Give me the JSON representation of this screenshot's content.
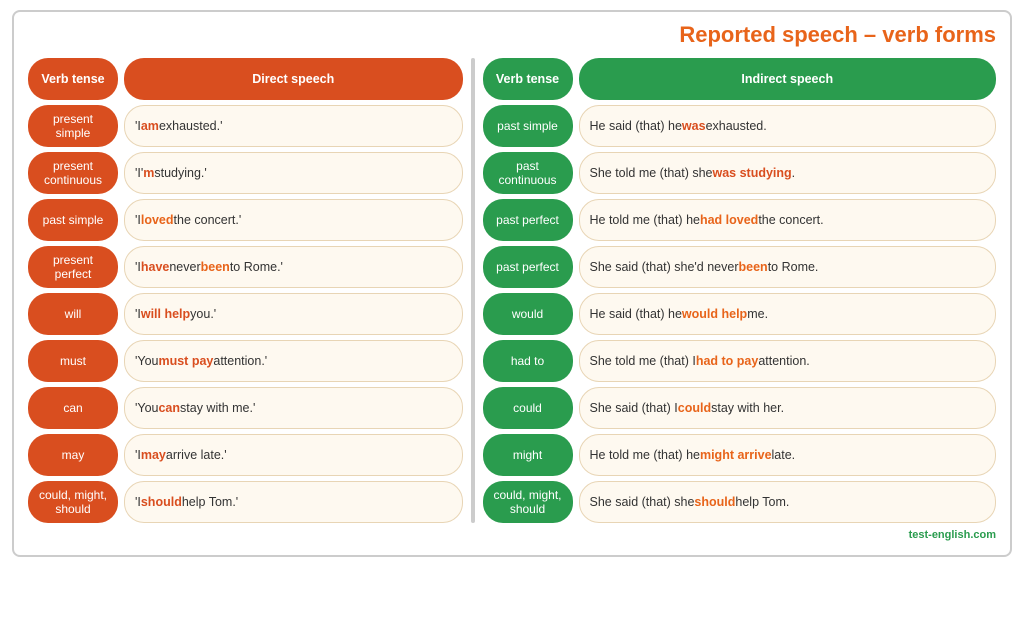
{
  "title": "Reported speech – verb forms",
  "direct_section": {
    "col1_header": "Verb tense",
    "col2_header": "Direct speech",
    "rows": [
      {
        "verb_tense": "present simple",
        "speech_html": "'I <b class=\"highlight-red\">am</b> exhausted.'"
      },
      {
        "verb_tense": "present continuous",
        "speech_html": "'I'<b class=\"highlight-red\">m</b> studying.'"
      },
      {
        "verb_tense": "past simple",
        "speech_html": "'I <b class=\"highlight-orange\">loved</b> the concert.'"
      },
      {
        "verb_tense": "present perfect",
        "speech_html": "'I <b class=\"highlight-red\">have</b> never <b class=\"highlight-orange\">been</b> to Rome.'"
      },
      {
        "verb_tense": "will",
        "speech_html": "'I <b class=\"highlight-red\">will help</b> you.'"
      },
      {
        "verb_tense": "must",
        "speech_html": "'You <b class=\"highlight-red\">must pay</b> attention.'"
      },
      {
        "verb_tense": "can",
        "speech_html": "'You <b class=\"highlight-red\">can</b> stay with me.'"
      },
      {
        "verb_tense": "may",
        "speech_html": "'I <b class=\"highlight-red\">may</b> arrive late.'"
      },
      {
        "verb_tense": "could, might, should",
        "speech_html": "'I <b class=\"highlight-red\">should</b> help Tom.'"
      }
    ]
  },
  "indirect_section": {
    "col1_header": "Verb tense",
    "col2_header": "Indirect speech",
    "rows": [
      {
        "verb_tense": "past simple",
        "speech_html": "He said (that) he <b class=\"highlight-red\">was</b> exhausted."
      },
      {
        "verb_tense": "past continuous",
        "speech_html": "She told me (that) she <b class=\"highlight-red\">was studying</b>."
      },
      {
        "verb_tense": "past perfect",
        "speech_html": "He told me (that) he <b class=\"highlight-orange\">had loved</b> the concert."
      },
      {
        "verb_tense": "past perfect",
        "speech_html": "She said (that) she'd never <b class=\"highlight-orange\">been</b> to Rome."
      },
      {
        "verb_tense": "would",
        "speech_html": "He said (that) he <b class=\"highlight-orange\">would help</b> me."
      },
      {
        "verb_tense": "had to",
        "speech_html": "She told me (that) I <b class=\"highlight-orange\">had to pay</b> attention."
      },
      {
        "verb_tense": "could",
        "speech_html": "She said (that) I <b class=\"highlight-orange\">could</b> stay with her."
      },
      {
        "verb_tense": "might",
        "speech_html": "He told me (that) he <b class=\"highlight-orange\">might arrive</b> late."
      },
      {
        "verb_tense": "could, might, should",
        "speech_html": "She said (that) she <b class=\"highlight-orange\">should</b> help Tom."
      }
    ]
  },
  "footer": "test-english.com"
}
